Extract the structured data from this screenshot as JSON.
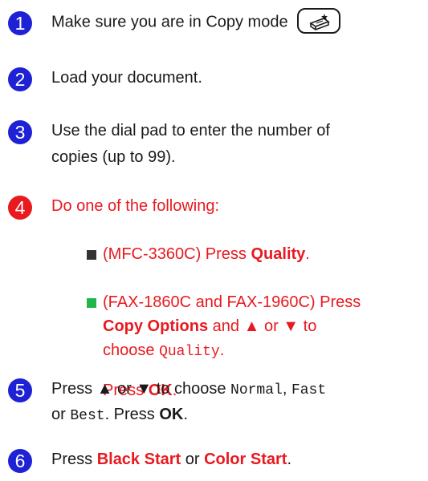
{
  "steps": [
    {
      "number": "1",
      "text": "Make sure you are in Copy mode"
    },
    {
      "number": "2",
      "text": "Load your document."
    },
    {
      "number": "3",
      "line1": "Use the dial pad to enter the number of",
      "line2": "copies (up to 99)."
    },
    {
      "number": "4",
      "text": "Do one of the following:"
    },
    {
      "number": "5"
    },
    {
      "number": "6"
    }
  ],
  "step4": {
    "bullet1": {
      "pre": "(MFC-3360C) Press ",
      "bold": "Quality",
      "post": "."
    },
    "bullet2": {
      "line1": "(FAX-1860C and FAX-1960C) Press",
      "line2_bold": "Copy Options",
      "line2_rest": " and ▲ or ▼ to",
      "line3_pre": "choose ",
      "line3_mono": "Quality",
      "line3_post": ".",
      "press_pre": "Press ",
      "press_bold": "OK",
      "press_post": "."
    }
  },
  "step5": {
    "line1_pre": "Press ▲ or ▼ to choose ",
    "opt_normal": "Normal",
    "comma": ", ",
    "opt_fast": "Fast",
    "line2_or": "or ",
    "opt_best": "Best",
    "line2_mid": ". Press ",
    "line2_ok": "OK",
    "line2_end": "."
  },
  "step6": {
    "pre": "Press ",
    "black_start": "Black Start",
    "mid": " or ",
    "color_start": "Color Start",
    "end": "."
  },
  "icons": {
    "copy_mode": "copy-mode-icon"
  },
  "colors": {
    "step_badge": "#1e22d4",
    "active_badge": "#e8191f",
    "highlight_text": "#e8191f",
    "bullet_green": "#22b54a"
  }
}
